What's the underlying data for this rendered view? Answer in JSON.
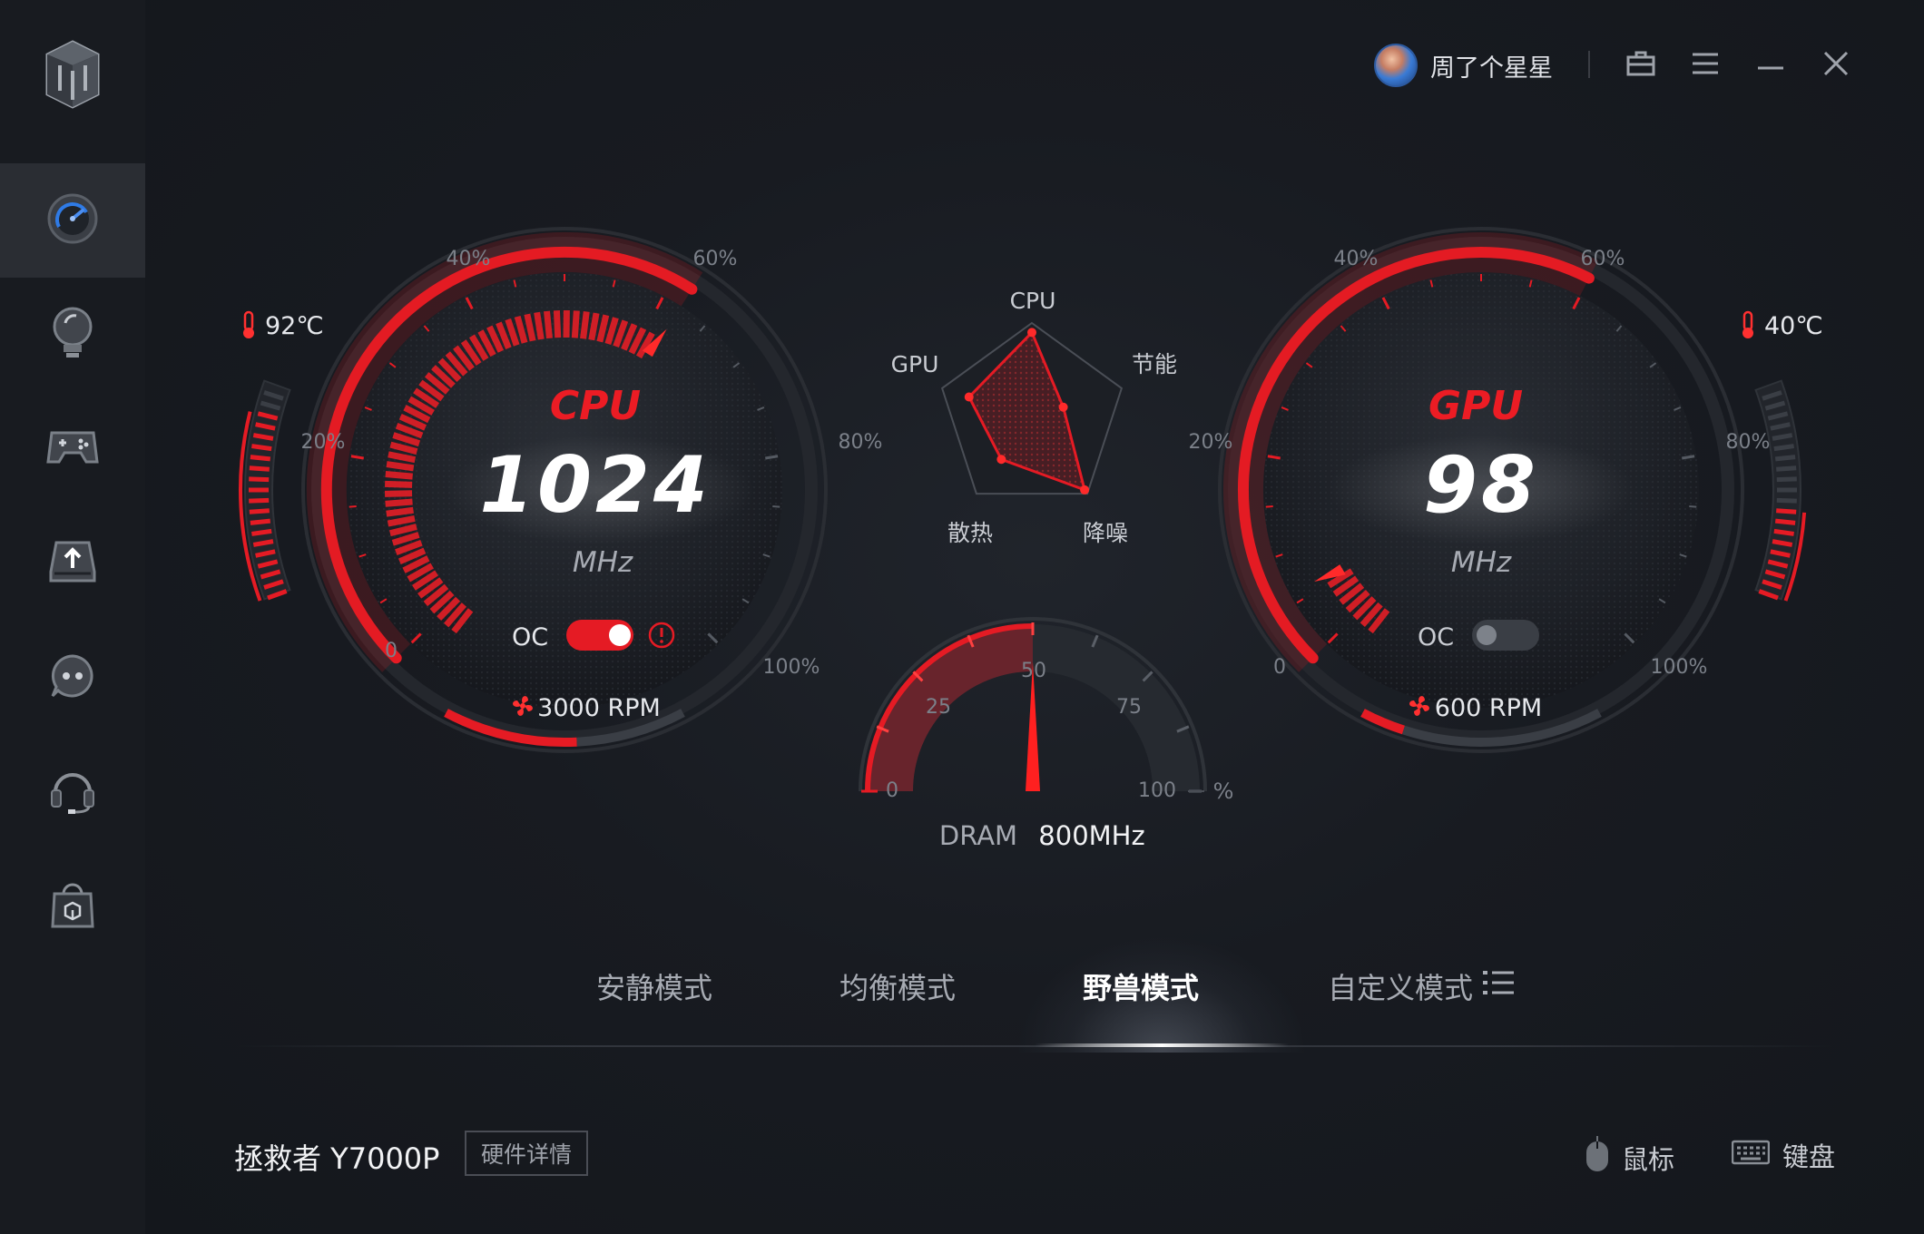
{
  "app": {
    "username": "周了个星星"
  },
  "sidebar": {
    "items": [
      {
        "icon": "speedometer-icon",
        "active": true
      },
      {
        "icon": "lightbulb-icon",
        "active": false
      },
      {
        "icon": "gamepad-icon",
        "active": false
      },
      {
        "icon": "download-icon",
        "active": false
      },
      {
        "icon": "robot-face-icon",
        "active": false
      },
      {
        "icon": "headset-icon",
        "active": false
      },
      {
        "icon": "shop-bag-icon",
        "active": false
      }
    ]
  },
  "cpu": {
    "label": "CPU",
    "value": "1024",
    "unit": "MHz",
    "temp": "92℃",
    "fan": "3000 RPM",
    "oc_label": "OC",
    "oc_on": true,
    "ticks": [
      "0",
      "20%",
      "40%",
      "60%",
      "80%",
      "100%"
    ],
    "load_fraction": 0.62,
    "temp_fraction": 0.85
  },
  "gpu": {
    "label": "GPU",
    "value": "98",
    "unit": "MHz",
    "temp": "40℃",
    "fan": "600 RPM",
    "oc_label": "OC",
    "oc_on": false,
    "ticks": [
      "0",
      "20%",
      "40%",
      "60%",
      "80%",
      "100%"
    ],
    "load_fraction": 0.6,
    "temp_fraction": 0.4
  },
  "radar": {
    "labels": {
      "top": "CPU",
      "upper_right": "节能",
      "lower_right": "降噪",
      "lower_left": "散热",
      "upper_left": "GPU"
    },
    "values": {
      "cpu": 0.9,
      "power_saving": 0.35,
      "noise_reduction": 0.95,
      "cooling": 0.55,
      "gpu": 0.7
    }
  },
  "dram": {
    "label": "DRAM",
    "value": "800MHz",
    "ticks": [
      "0",
      "25",
      "50",
      "75",
      "100"
    ],
    "percent_symbol": "%",
    "percent": 50
  },
  "modes": [
    {
      "label": "安静模式",
      "active": false
    },
    {
      "label": "均衡模式",
      "active": false
    },
    {
      "label": "野兽模式",
      "active": true
    },
    {
      "label": "自定义模式",
      "active": false
    }
  ],
  "footer": {
    "device": "拯救者 Y7000P",
    "hw_details": "硬件详情",
    "mouse": "鼠标",
    "keyboard": "键盘"
  },
  "colors": {
    "accent": "#e51b24",
    "background": "#14171c",
    "sidebar": "#181b20"
  }
}
